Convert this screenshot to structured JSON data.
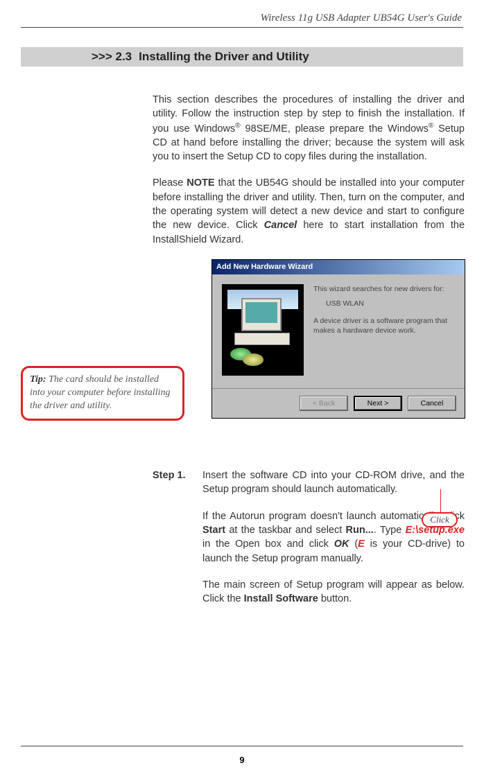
{
  "header": {
    "guide_title": "Wireless 11g USB Adapter UB54G User's Guide"
  },
  "section": {
    "number": ">>> 2.3",
    "title": "Installing the Driver and Utility"
  },
  "intro": {
    "p1_a": "This section describes the procedures of installing the driver and utility.  Follow the instruction step by step to finish the installation.  If you use Windows",
    "p1_b": " 98SE/ME, please prepare the Windows",
    "p1_c": " Setup CD at hand before installing the driver; because the system will ask you to insert the Setup CD to copy files during the installation.",
    "reg": "®",
    "p2_a": "Please ",
    "p2_note": "NOTE",
    "p2_b": " that the UB54G should be installed into your computer before installing the driver and utility.  Then, turn on the computer, and the operating system will detect a new device and start to configure the new device.  Click ",
    "p2_cancel": "Cancel",
    "p2_c": " here to start installation from the InstallShield Wizard."
  },
  "tip": {
    "label": "Tip:",
    "text": " The card should be installed into your computer before installing the driver and utility."
  },
  "wizard": {
    "title": "Add New Hardware Wizard",
    "line1": "This wizard searches for new drivers for:",
    "device": "USB WLAN",
    "line2": "A device driver is a software program that makes a hardware device work.",
    "back": "< Back",
    "next": "Next >",
    "cancel": "Cancel"
  },
  "callout": {
    "click": "Click"
  },
  "step1": {
    "label": "Step 1.",
    "p1": "Insert the software CD into your CD-ROM drive, and the Setup program should launch automatically.",
    "p2_a": "If the Autorun program doesn't launch automatically, click ",
    "p2_start": "Start",
    "p2_b": " at the taskbar and select ",
    "p2_run": "Run...",
    "p2_c": ".  Type ",
    "p2_path": "E:\\setup.exe",
    "p2_d": " in the Open box and click ",
    "p2_ok": "OK",
    "p2_e": " (",
    "p2_E": "E",
    "p2_f": " is your CD-drive) to launch the Setup program manually.",
    "p3_a": "The main screen of Setup program will appear as below. Click the ",
    "p3_install": "Install Software",
    "p3_b": " button."
  },
  "footer": {
    "page": "9"
  }
}
